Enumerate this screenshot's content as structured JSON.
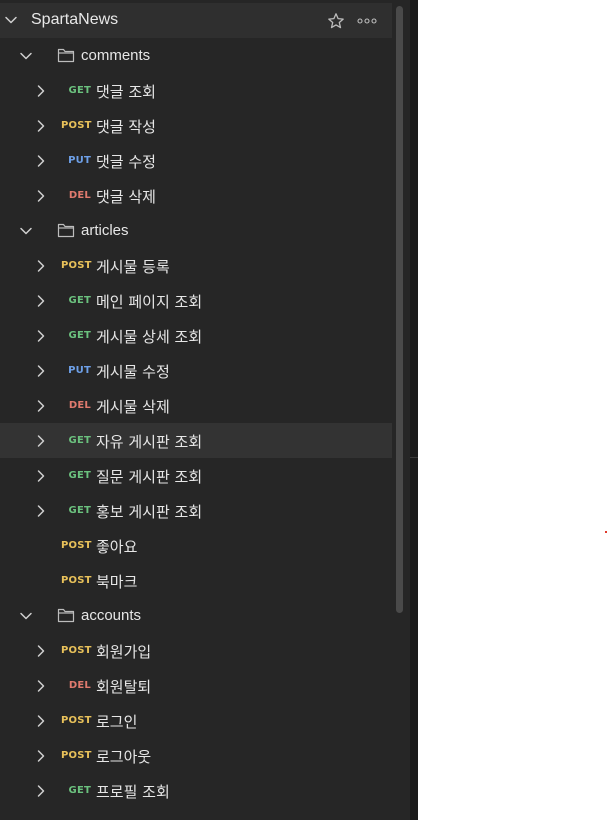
{
  "collection": {
    "name": "SpartaNews"
  },
  "icons": {
    "collapse": "chevron-down-icon",
    "expand": "chevron-right-icon",
    "folder": "folder-icon",
    "favorite": "star-icon",
    "more": "more-icon"
  },
  "colors": {
    "GET": "#6bc17e",
    "POST": "#e8c15a",
    "PUT": "#6ea0e8",
    "DEL": "#e07a6e",
    "sidebar_bg": "#262626"
  },
  "tree": [
    {
      "type": "folder",
      "name": "comments"
    },
    {
      "type": "request",
      "method": "GET",
      "name": "댓글 조회",
      "chevron": true
    },
    {
      "type": "request",
      "method": "POST",
      "name": "댓글 작성",
      "chevron": true
    },
    {
      "type": "request",
      "method": "PUT",
      "name": "댓글 수정",
      "chevron": true
    },
    {
      "type": "request",
      "method": "DEL",
      "name": "댓글 삭제",
      "chevron": true
    },
    {
      "type": "folder",
      "name": "articles"
    },
    {
      "type": "request",
      "method": "POST",
      "name": "게시물 등록",
      "chevron": true
    },
    {
      "type": "request",
      "method": "GET",
      "name": "메인 페이지 조회",
      "chevron": true
    },
    {
      "type": "request",
      "method": "GET",
      "name": "게시물 상세 조회",
      "chevron": true
    },
    {
      "type": "request",
      "method": "PUT",
      "name": "게시물 수정",
      "chevron": true
    },
    {
      "type": "request",
      "method": "DEL",
      "name": "게시물 삭제",
      "chevron": true
    },
    {
      "type": "request",
      "method": "GET",
      "name": "자유 게시판 조회",
      "chevron": true,
      "hovered": true
    },
    {
      "type": "request",
      "method": "GET",
      "name": "질문 게시판 조회",
      "chevron": true
    },
    {
      "type": "request",
      "method": "GET",
      "name": "홍보 게시판 조회",
      "chevron": true
    },
    {
      "type": "request",
      "method": "POST",
      "name": "좋아요",
      "chevron": false
    },
    {
      "type": "request",
      "method": "POST",
      "name": "북마크",
      "chevron": false
    },
    {
      "type": "folder",
      "name": "accounts"
    },
    {
      "type": "request",
      "method": "POST",
      "name": "회원가입",
      "chevron": true
    },
    {
      "type": "request",
      "method": "DEL",
      "name": "회원탈퇴",
      "chevron": true
    },
    {
      "type": "request",
      "method": "POST",
      "name": "로그인",
      "chevron": true
    },
    {
      "type": "request",
      "method": "POST",
      "name": "로그아웃",
      "chevron": true
    },
    {
      "type": "request",
      "method": "GET",
      "name": "프로필 조회",
      "chevron": true
    }
  ]
}
